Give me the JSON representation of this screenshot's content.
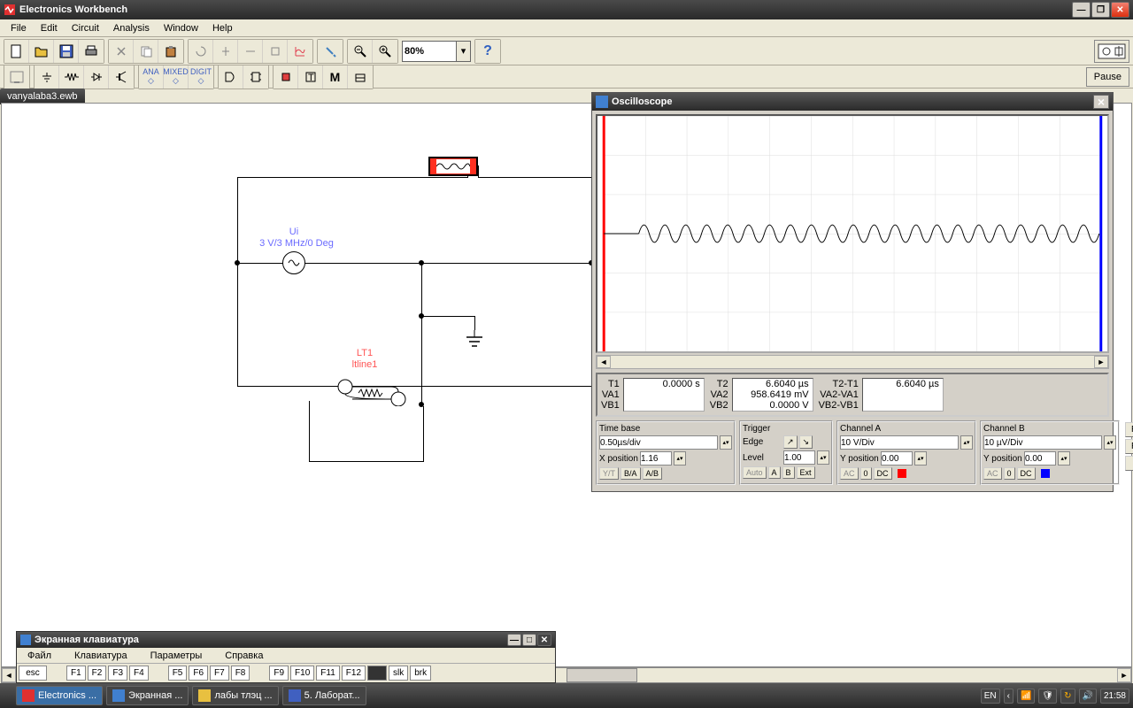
{
  "app": {
    "title": "Electronics Workbench",
    "doc_filename": "vanyalaba3.ewb"
  },
  "menus": {
    "file": "File",
    "edit": "Edit",
    "circuit": "Circuit",
    "analysis": "Analysis",
    "window": "Window",
    "help": "Help"
  },
  "toolbar": {
    "zoom": "80%",
    "pause": "Pause"
  },
  "schematic": {
    "source_name": "Ui",
    "source_spec": "3 V/3 MHz/0 Deg",
    "tline_name": "LT1",
    "tline_ref": "ltline1"
  },
  "oscilloscope": {
    "title": "Oscilloscope",
    "readout": {
      "t1_label": "T1",
      "va1_label": "VA1",
      "vb1_label": "VB1",
      "t2_label": "T2",
      "va2_label": "VA2",
      "vb2_label": "VB2",
      "dt_label": "T2-T1",
      "dva_label": "VA2-VA1",
      "dvb_label": "VB2-VB1",
      "t1": "0.0000  s",
      "t2": "6.6040 µs",
      "va2": "958.6419 mV",
      "vb2": "0.0000  V",
      "dt": "6.6040 µs"
    },
    "timebase": {
      "title": "Time base",
      "div": "0.50µs/div",
      "xpos_label": "X position",
      "xpos": "1.16",
      "yt": "Y/T",
      "ba": "B/A",
      "ab": "A/B"
    },
    "trigger": {
      "title": "Trigger",
      "edge_label": "Edge",
      "level_label": "Level",
      "level": "1.00",
      "auto": "Auto",
      "a": "A",
      "b": "B",
      "ext": "Ext"
    },
    "channel_a": {
      "title": "Channel A",
      "div": "10 V/Div",
      "ypos_label": "Y position",
      "ypos": "0.00",
      "ac": "AC",
      "zero": "0",
      "dc": "DC"
    },
    "channel_b": {
      "title": "Channel B",
      "div": "10 µV/Div",
      "ypos_label": "Y position",
      "ypos": "0.00",
      "ac": "AC",
      "zero": "0",
      "dc": "DC"
    },
    "buttons": {
      "reduce": "Reduce",
      "reverse": "Reverse",
      "save": "Save"
    }
  },
  "osk": {
    "title": "Экранная клавиатура",
    "menus": {
      "file": "Файл",
      "kb": "Клавиатура",
      "params": "Параметры",
      "help": "Справка"
    },
    "keys": {
      "esc": "esc",
      "f1": "F1",
      "f2": "F2",
      "f3": "F3",
      "f4": "F4",
      "f5": "F5",
      "f6": "F6",
      "f7": "F7",
      "f8": "F8",
      "f9": "F9",
      "f10": "F10",
      "f11": "F11",
      "f12": "F12",
      "slk": "slk",
      "brk": "brk"
    }
  },
  "taskbar": {
    "items": {
      "workbench": "Electronics ...",
      "osk": "Экранная ...",
      "labs": "лабы тлэц ...",
      "doc5": "5. Лаборат..."
    },
    "lang": "EN",
    "time": "21:58"
  }
}
